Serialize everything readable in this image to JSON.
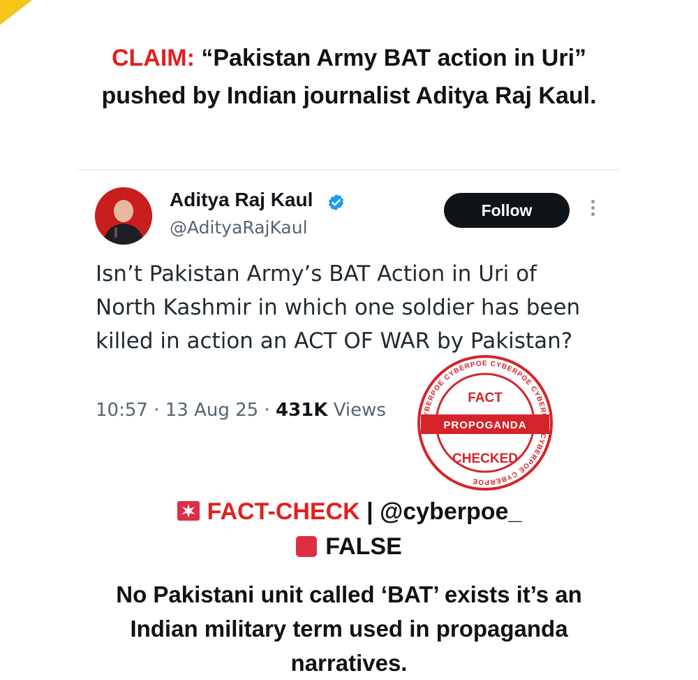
{
  "claim": {
    "label": "CLAIM:",
    "text": " “Pakistan Army BAT action in Uri” pushed by Indian journalist Aditya Raj Kaul."
  },
  "tweet": {
    "author_name": "Aditya Raj Kaul",
    "handle": "@AdityaRajKaul",
    "follow_label": "Follow",
    "text": "Isn’t Pakistan Army’s BAT Action in Uri of North Kashmir in which one soldier has been killed in action an ACT OF WAR by Pakistan?",
    "time": "10:57",
    "date": "13 Aug 25",
    "views_count": "431K",
    "views_label": "Views",
    "icons": [
      "verified-badge-icon",
      "more-options-icon"
    ]
  },
  "stamp": {
    "top": "FACT",
    "band": "PROPOGANDA",
    "bottom": "CHECKED",
    "ring_text": "CYBERPOE CYBERPOE CYBERPOE CYBERPOE CYBERPOE CYBERPOE"
  },
  "verdict": {
    "factcheck_label": "FACT-CHECK",
    "source": " | @cyberpoe_",
    "result": "FALSE",
    "explanation": "No Pakistani unit called ‘BAT’ exists it’s an Indian military term used in propaganda narratives."
  },
  "colors": {
    "claim_red": "#e0201e",
    "follow_bg": "#0f1419",
    "verified_blue": "#1d9bf0",
    "stamp_red": "#d4242a",
    "ribbon_yellow": "#f5c518"
  }
}
